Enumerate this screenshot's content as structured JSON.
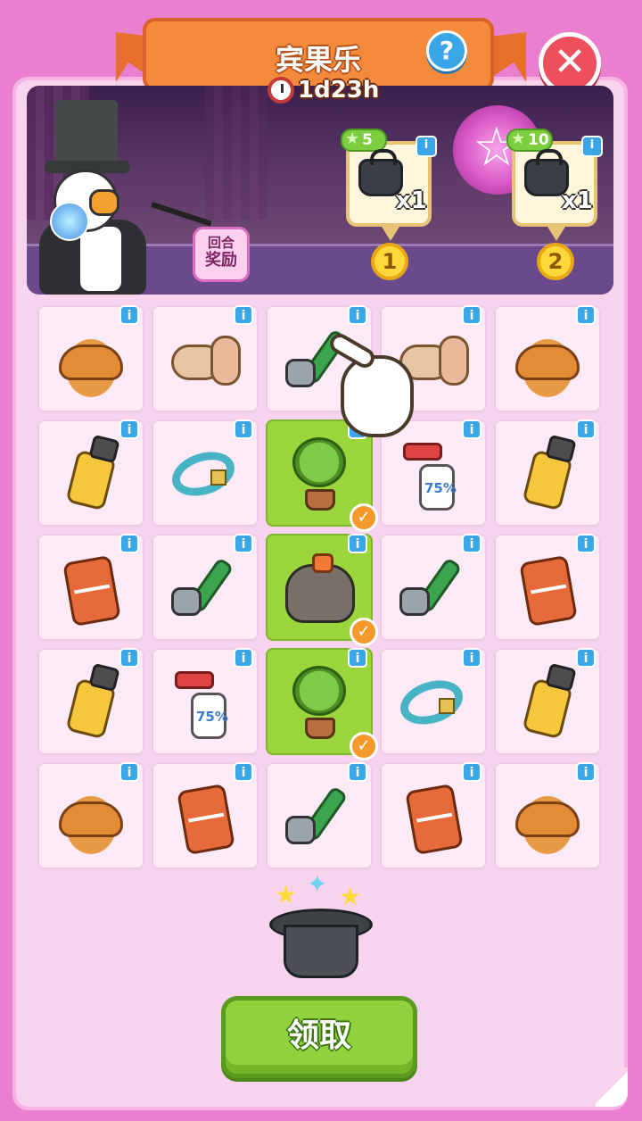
{
  "header": {
    "title": "宾果乐",
    "help_icon": "?",
    "close_icon": "✕",
    "timer": "1d23h"
  },
  "stage": {
    "round_badge_line1": "回合",
    "round_badge_line2": "奖励",
    "rewards": [
      {
        "points": "5",
        "qty": "x1",
        "medal": "1",
        "item": "black-bag-icon"
      },
      {
        "points": "10",
        "qty": "x1",
        "medal": "2",
        "item": "black-bag-icon"
      }
    ]
  },
  "board": {
    "info_label": "i",
    "check_label": "✓",
    "rows": [
      [
        {
          "item": "croissant",
          "marked": false
        },
        {
          "item": "roll",
          "marked": false
        },
        {
          "item": "pliers",
          "marked": false
        },
        {
          "item": "roll",
          "marked": false
        },
        {
          "item": "croissant",
          "marked": false
        }
      ],
      [
        {
          "item": "bottle",
          "marked": false
        },
        {
          "item": "ring",
          "marked": false
        },
        {
          "item": "plant",
          "marked": true
        },
        {
          "item": "spray",
          "marked": false
        },
        {
          "item": "bottle",
          "marked": false
        }
      ],
      [
        {
          "item": "can",
          "marked": false
        },
        {
          "item": "pliers",
          "marked": false
        },
        {
          "item": "bag",
          "marked": true
        },
        {
          "item": "pliers",
          "marked": false
        },
        {
          "item": "can",
          "marked": false
        }
      ],
      [
        {
          "item": "bottle",
          "marked": false
        },
        {
          "item": "spray",
          "marked": false
        },
        {
          "item": "plant",
          "marked": true
        },
        {
          "item": "ring",
          "marked": false
        },
        {
          "item": "bottle",
          "marked": false
        }
      ],
      [
        {
          "item": "croissant",
          "marked": false
        },
        {
          "item": "can",
          "marked": false
        },
        {
          "item": "pliers",
          "marked": false
        },
        {
          "item": "can",
          "marked": false
        },
        {
          "item": "croissant",
          "marked": false
        }
      ]
    ]
  },
  "claim_button": "领取"
}
